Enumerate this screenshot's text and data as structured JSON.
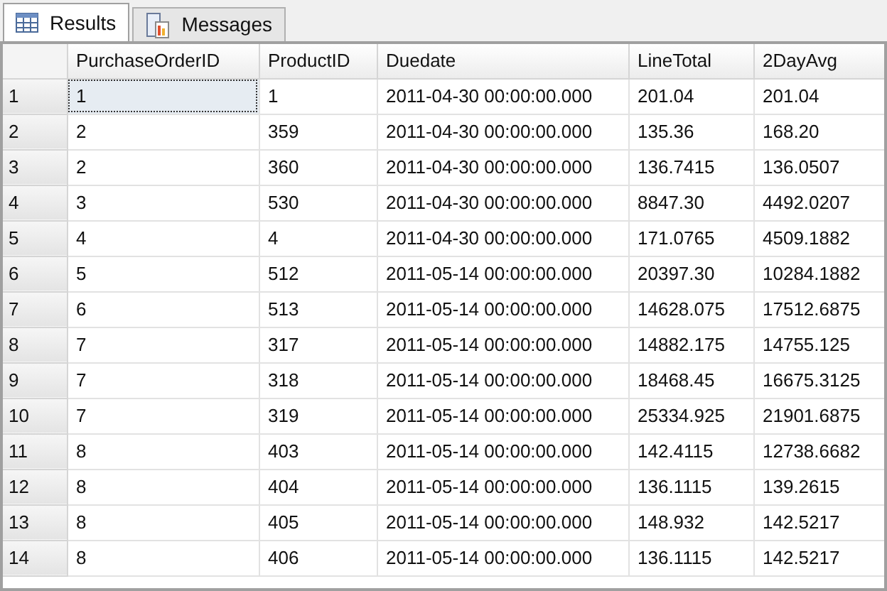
{
  "tabs": [
    {
      "label": "Results",
      "selected": true
    },
    {
      "label": "Messages",
      "selected": false
    }
  ],
  "table": {
    "columns": [
      "PurchaseOrderID",
      "ProductID",
      "Duedate",
      "LineTotal",
      "2DayAvg"
    ],
    "rows": [
      {
        "number": "1",
        "selected": true,
        "cells": [
          "1",
          "1",
          "2011-04-30 00:00:00.000",
          "201.04",
          "201.04"
        ]
      },
      {
        "number": "2",
        "selected": false,
        "cells": [
          "2",
          "359",
          "2011-04-30 00:00:00.000",
          "135.36",
          "168.20"
        ]
      },
      {
        "number": "3",
        "selected": false,
        "cells": [
          "2",
          "360",
          "2011-04-30 00:00:00.000",
          "136.7415",
          "136.0507"
        ]
      },
      {
        "number": "4",
        "selected": false,
        "cells": [
          "3",
          "530",
          "2011-04-30 00:00:00.000",
          "8847.30",
          "4492.0207"
        ]
      },
      {
        "number": "5",
        "selected": false,
        "cells": [
          "4",
          "4",
          "2011-04-30 00:00:00.000",
          "171.0765",
          "4509.1882"
        ]
      },
      {
        "number": "6",
        "selected": false,
        "cells": [
          "5",
          "512",
          "2011-05-14 00:00:00.000",
          "20397.30",
          "10284.1882"
        ]
      },
      {
        "number": "7",
        "selected": false,
        "cells": [
          "6",
          "513",
          "2011-05-14 00:00:00.000",
          "14628.075",
          "17512.6875"
        ]
      },
      {
        "number": "8",
        "selected": false,
        "cells": [
          "7",
          "317",
          "2011-05-14 00:00:00.000",
          "14882.175",
          "14755.125"
        ]
      },
      {
        "number": "9",
        "selected": false,
        "cells": [
          "7",
          "318",
          "2011-05-14 00:00:00.000",
          "18468.45",
          "16675.3125"
        ]
      },
      {
        "number": "10",
        "selected": false,
        "cells": [
          "7",
          "319",
          "2011-05-14 00:00:00.000",
          "25334.925",
          "21901.6875"
        ]
      },
      {
        "number": "11",
        "selected": false,
        "cells": [
          "8",
          "403",
          "2011-05-14 00:00:00.000",
          "142.4115",
          "12738.6682"
        ]
      },
      {
        "number": "12",
        "selected": false,
        "cells": [
          "8",
          "404",
          "2011-05-14 00:00:00.000",
          "136.1115",
          "139.2615"
        ]
      },
      {
        "number": "13",
        "selected": false,
        "cells": [
          "8",
          "405",
          "2011-05-14 00:00:00.000",
          "148.932",
          "142.5217"
        ]
      },
      {
        "number": "14",
        "selected": false,
        "cells": [
          "8",
          "406",
          "2011-05-14 00:00:00.000",
          "136.1115",
          "142.5217"
        ]
      }
    ]
  }
}
